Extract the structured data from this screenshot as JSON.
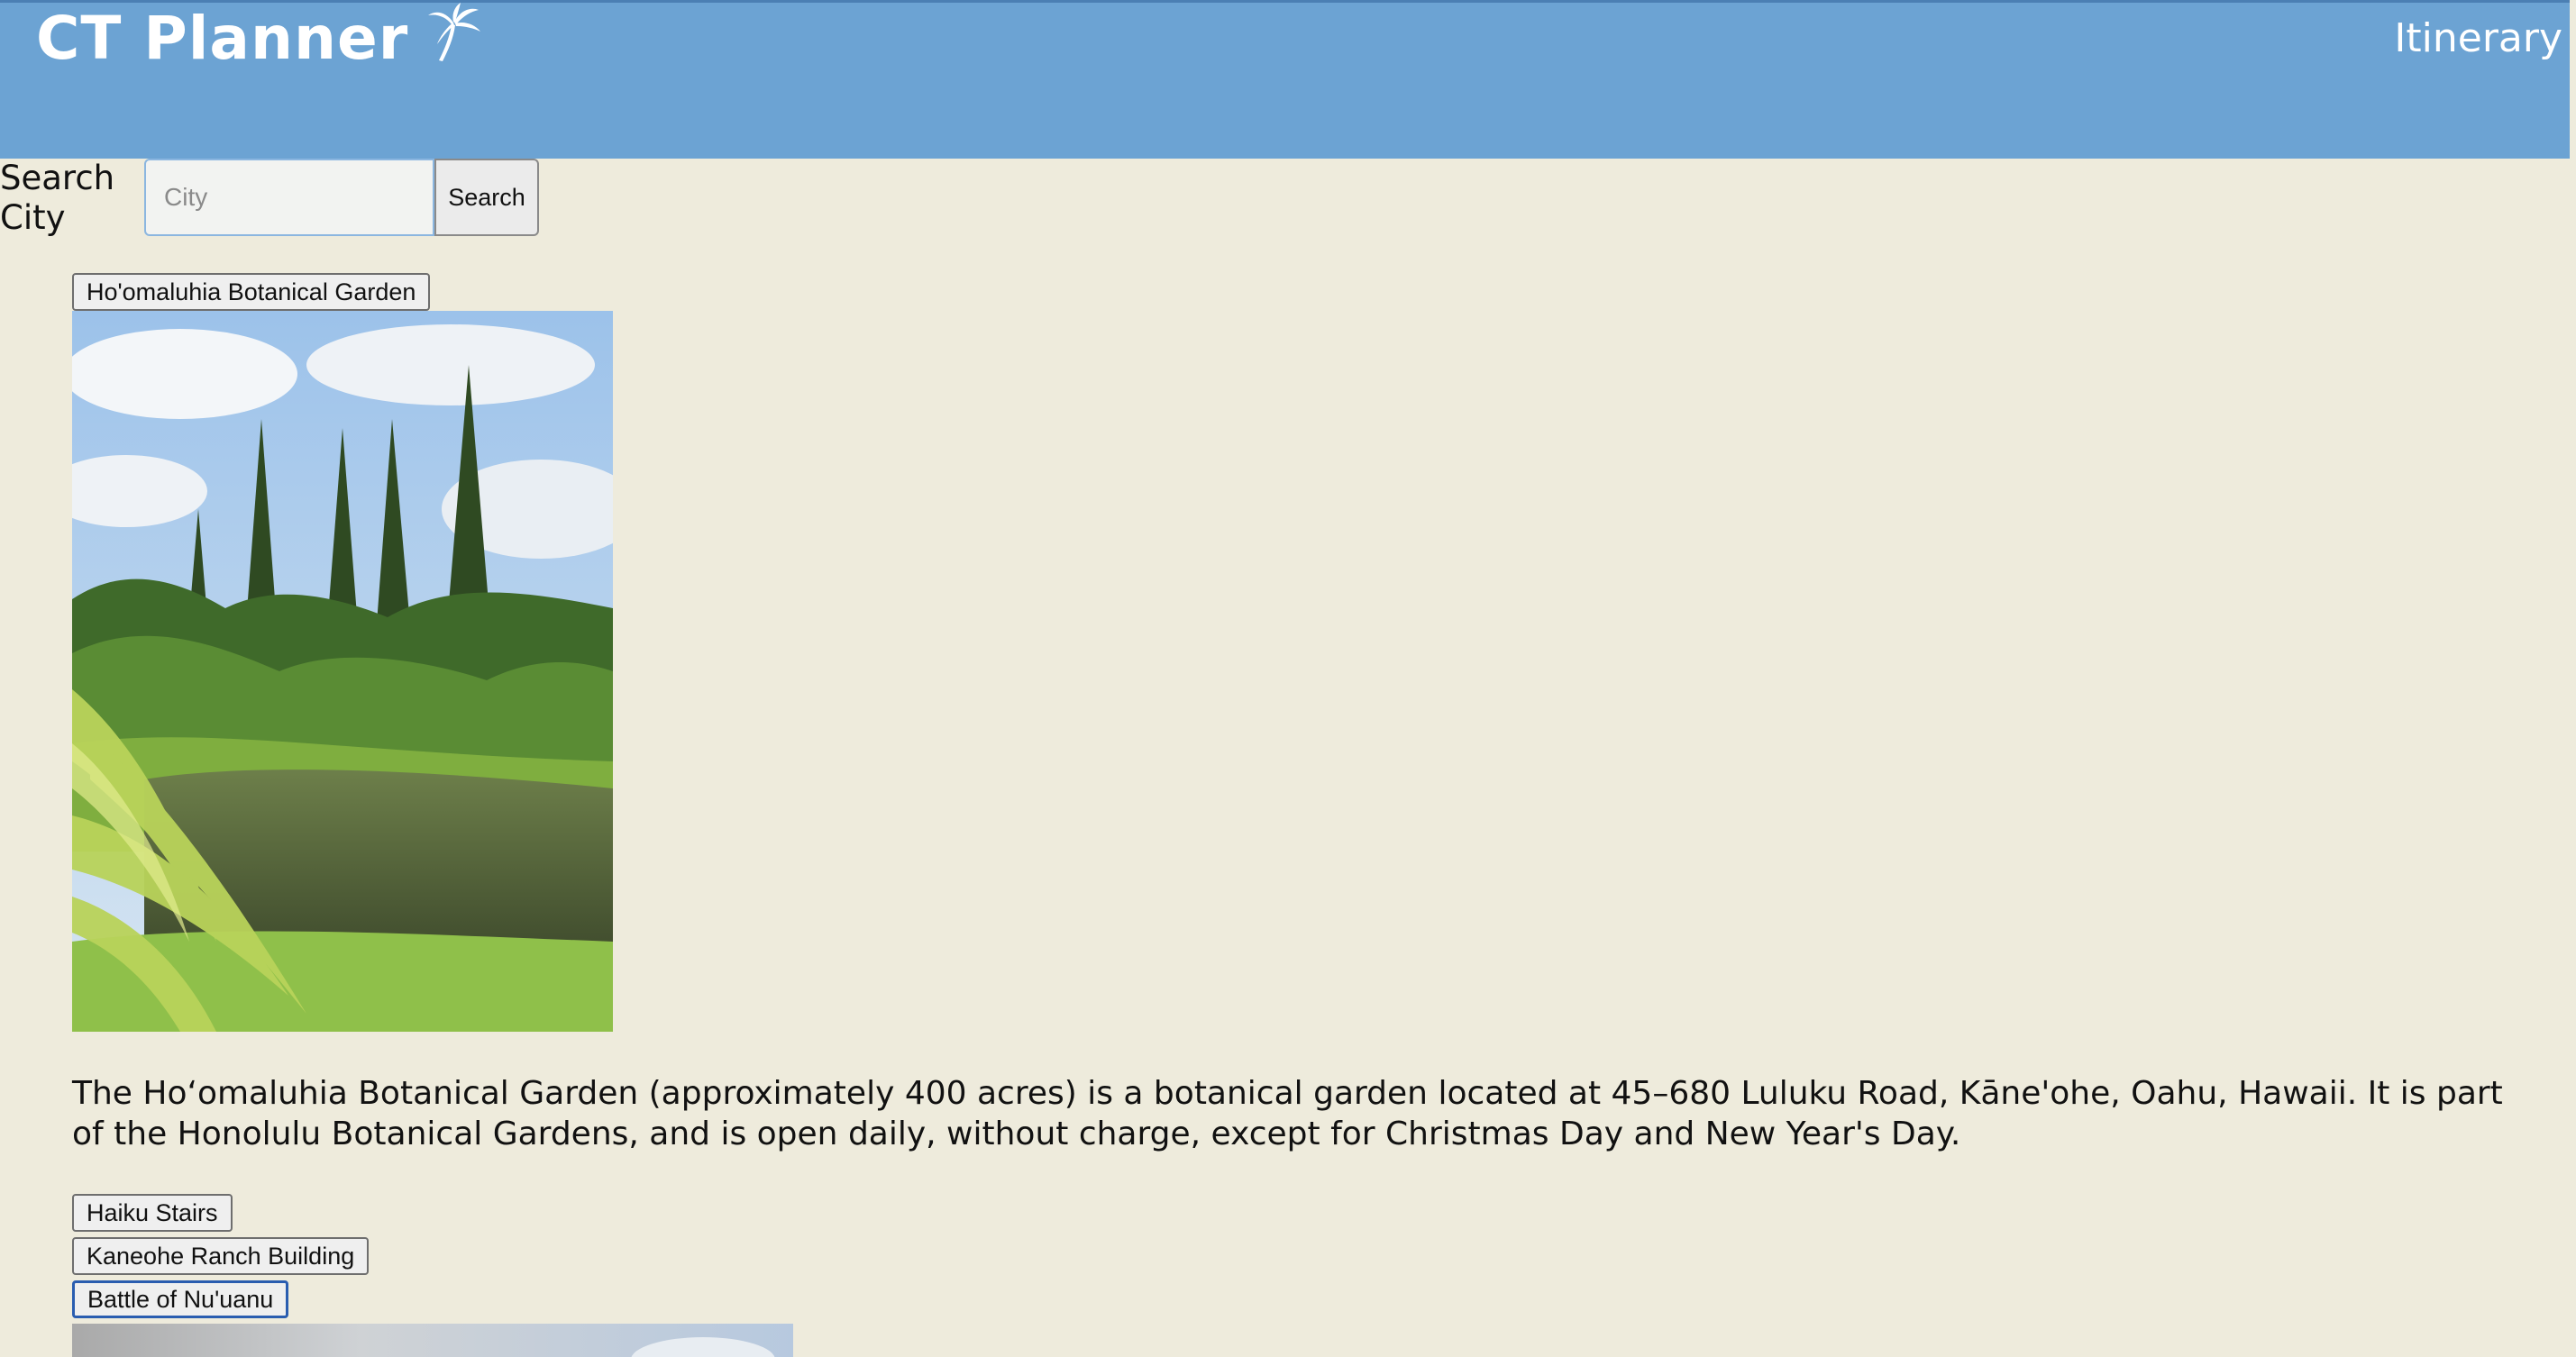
{
  "header": {
    "title": "CT Planner",
    "logo_icon": "palm-tree-icon",
    "nav_link": "Itinerary",
    "background_color": "#6ca3d3"
  },
  "search": {
    "label": "Search City",
    "placeholder": "City",
    "value": "",
    "button_label": "Search"
  },
  "places": {
    "selected": {
      "name": "Ho'omaluhia Botanical Garden",
      "image_alt": "Ho'omaluhia Botanical Garden",
      "description": "The Hoʻomaluhia Botanical Garden (approximately 400 acres) is a botanical garden located at 45–680 Luluku Road, Kāne'ohe, Oahu, Hawaii. It is part of the Honolulu Botanical Gardens, and is open daily, without charge, except for Christmas Day and New Year's Day."
    },
    "list": [
      {
        "name": "Haiku Stairs"
      },
      {
        "name": "Kaneohe Ranch Building"
      },
      {
        "name": "Battle of Nu'uanu"
      }
    ],
    "focused_index": 2
  }
}
